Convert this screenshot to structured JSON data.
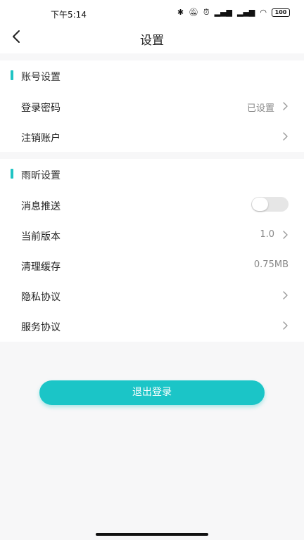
{
  "status_bar": {
    "time": "下午5:14",
    "battery": "100"
  },
  "nav": {
    "title": "设置",
    "back_icon": "chevron-left-icon"
  },
  "sections": {
    "account": {
      "title": "账号设置",
      "items": [
        {
          "label": "登录密码",
          "value": "已设置"
        },
        {
          "label": "注销账户",
          "value": ""
        }
      ]
    },
    "app": {
      "title": "雨昕设置",
      "items": [
        {
          "label": "消息推送",
          "toggle_on": false
        },
        {
          "label": "当前版本",
          "value": "1.0"
        },
        {
          "label": "清理缓存",
          "value": "0.75MB"
        },
        {
          "label": "隐私协议",
          "value": ""
        },
        {
          "label": "服务协议",
          "value": ""
        }
      ]
    }
  },
  "logout": {
    "label": "退出登录"
  },
  "colors": {
    "accent": "#1bc5c7",
    "section_bar": "#20c4c4",
    "background": "#f7f7f8"
  }
}
